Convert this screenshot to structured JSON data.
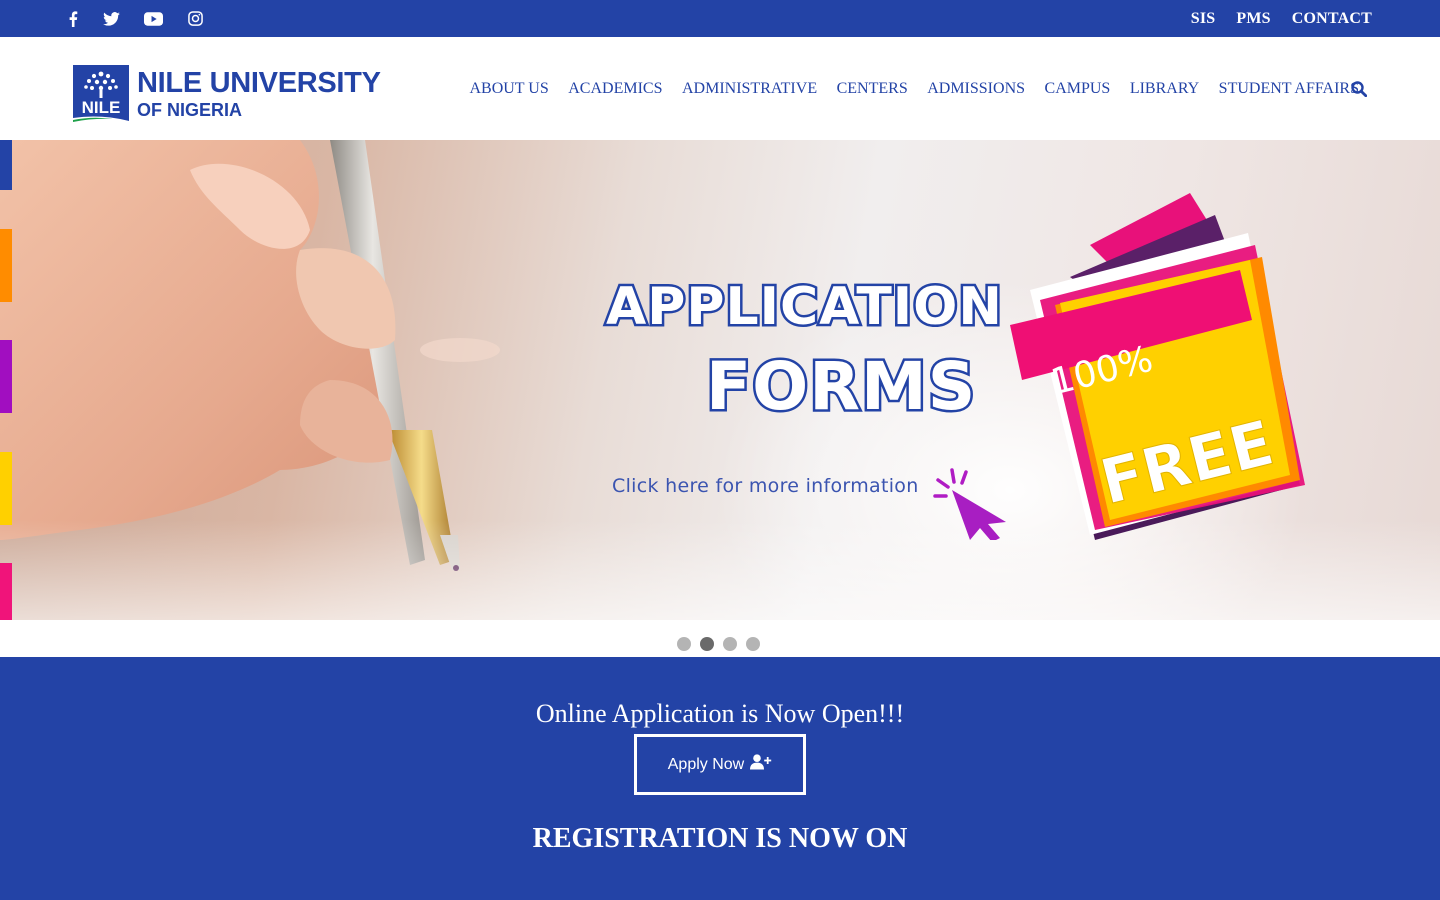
{
  "topbar": {
    "social": [
      {
        "name": "facebook-icon"
      },
      {
        "name": "twitter-icon"
      },
      {
        "name": "youtube-icon"
      },
      {
        "name": "instagram-icon"
      }
    ],
    "links": [
      "SIS",
      "PMS",
      "CONTACT"
    ],
    "background": "#2343a6"
  },
  "brand": {
    "logo_text": "NILE",
    "title": "NILE UNIVERSITY",
    "subtitle": "OF NIGERIA",
    "color": "#2343a6"
  },
  "nav": {
    "items": [
      "ABOUT US",
      "ACADEMICS",
      "ADMINISTRATIVE",
      "CENTERS",
      "ADMISSIONS",
      "CAMPUS",
      "LIBRARY",
      "STUDENT AFFAIRS"
    ],
    "search_icon": "search-icon"
  },
  "hero": {
    "title_line1": "APPLICATION",
    "title_line2": "FORMS",
    "link_text": "Click here for more information",
    "badge_percent": "100%",
    "badge_word": "FREE",
    "side_tab_colors": [
      "#2343a6",
      "#ff8c00",
      "#a10ec0",
      "#ffd000",
      "#f0147a"
    ]
  },
  "carousel": {
    "slide_count": 4,
    "active_index": 1
  },
  "cta": {
    "title": "Online Application is Now Open!!!",
    "button_label": "Apply Now",
    "button_icon": "user-plus-icon",
    "registration_text": "REGISTRATION IS NOW ON"
  }
}
